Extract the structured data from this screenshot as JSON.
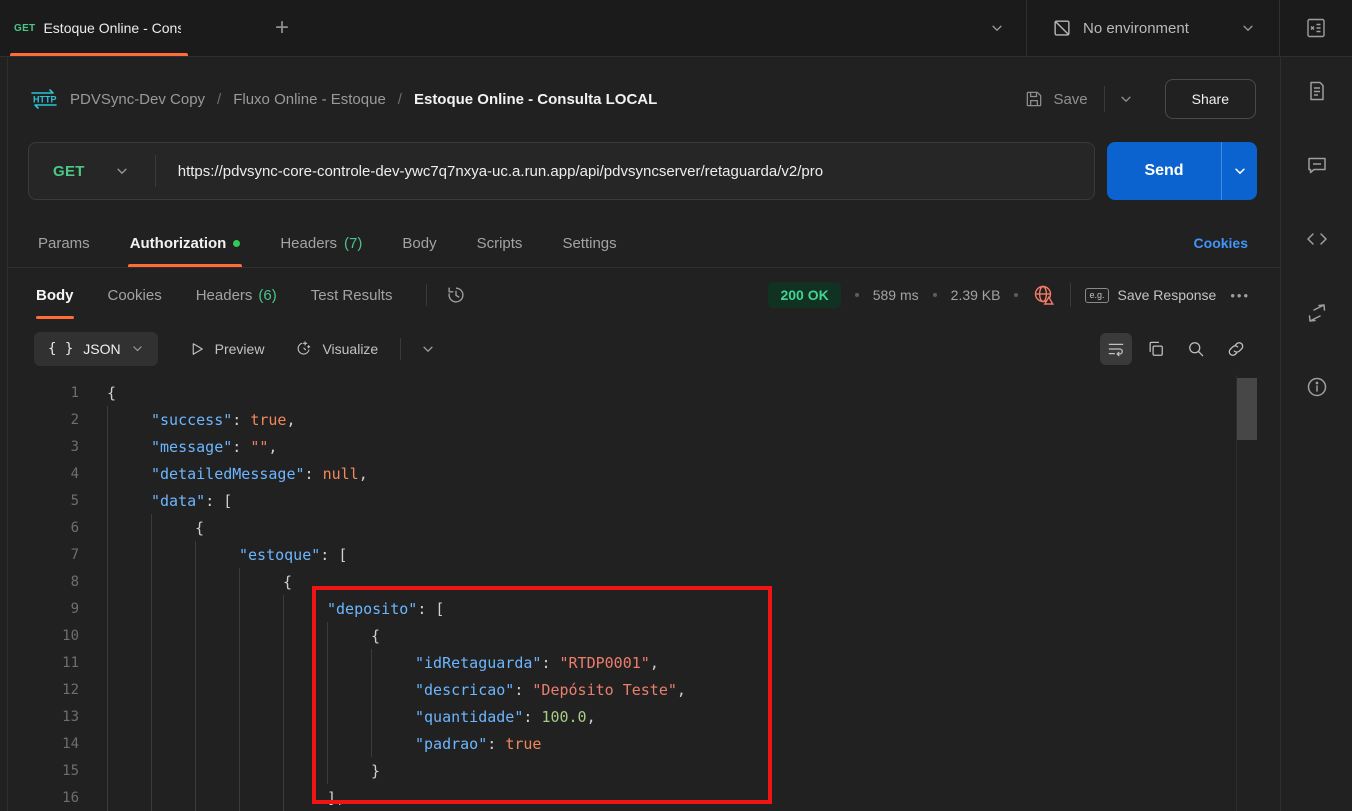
{
  "colors": {
    "accent_orange": "#ff6c37",
    "method_green": "#4ac885",
    "count_green": "#4cc38a",
    "link_blue": "#4294f7",
    "send_blue": "#0a63cf",
    "status_green": "#42d392",
    "annotation_red": "#f01414",
    "http_icon_cyan": "#2bc4d9",
    "globe_warning": "#f47b67",
    "code_key_blue": "#6cb6ff",
    "code_string_salmon": "#ec7e6d",
    "code_bool_orange": "#f0885c",
    "code_number_green": "#a9cc84"
  },
  "topbar": {
    "tab": {
      "method": "GET",
      "title": "Estoque Online - Consult"
    },
    "new_tab_label": "+",
    "environment_label": "No environment"
  },
  "header": {
    "breadcrumb": [
      "PDVSync-Dev Copy",
      "Fluxo Online - Estoque",
      "Estoque Online - Consulta LOCAL"
    ],
    "separator": "/",
    "save_label": "Save",
    "share_label": "Share"
  },
  "request": {
    "method": "GET",
    "url": "https://pdvsync-core-controle-dev-ywc7q7nxya-uc.a.run.app/api/pdvsyncserver/retaguarda/v2/pro",
    "send_label": "Send",
    "tabs": [
      {
        "label": "Params"
      },
      {
        "label": "Authorization"
      },
      {
        "label": "Headers",
        "count": "(7)"
      },
      {
        "label": "Body"
      },
      {
        "label": "Scripts"
      },
      {
        "label": "Settings"
      }
    ],
    "cookies_link": "Cookies"
  },
  "response": {
    "tabs": [
      {
        "label": "Body"
      },
      {
        "label": "Cookies"
      },
      {
        "label": "Headers",
        "count": "(6)"
      },
      {
        "label": "Test Results"
      }
    ],
    "status": "200 OK",
    "time": "589 ms",
    "size": "2.39 KB",
    "eg_label": "e.g.",
    "save_response_label": "Save Response",
    "more_label": "•••"
  },
  "viewer": {
    "braces": "{ }",
    "format_label": "JSON",
    "preview_label": "Preview",
    "visualize_label": "Visualize"
  },
  "code": {
    "lines": [
      {
        "num": 1,
        "depth": 0,
        "segments": [
          [
            "p",
            "{"
          ]
        ]
      },
      {
        "num": 2,
        "depth": 1,
        "segments": [
          [
            "k",
            "\"success\""
          ],
          [
            "p",
            ": "
          ],
          [
            "b",
            "true"
          ],
          [
            "p",
            ","
          ]
        ]
      },
      {
        "num": 3,
        "depth": 1,
        "segments": [
          [
            "k",
            "\"message\""
          ],
          [
            "p",
            ": "
          ],
          [
            "s",
            "\"\""
          ],
          [
            "p",
            ","
          ]
        ]
      },
      {
        "num": 4,
        "depth": 1,
        "segments": [
          [
            "k",
            "\"detailedMessage\""
          ],
          [
            "p",
            ": "
          ],
          [
            "b",
            "null"
          ],
          [
            "p",
            ","
          ]
        ]
      },
      {
        "num": 5,
        "depth": 1,
        "segments": [
          [
            "k",
            "\"data\""
          ],
          [
            "p",
            ": ["
          ]
        ]
      },
      {
        "num": 6,
        "depth": 2,
        "segments": [
          [
            "p",
            "{"
          ]
        ]
      },
      {
        "num": 7,
        "depth": 3,
        "segments": [
          [
            "k",
            "\"estoque\""
          ],
          [
            "p",
            ": ["
          ]
        ]
      },
      {
        "num": 8,
        "depth": 4,
        "segments": [
          [
            "p",
            "{"
          ]
        ]
      },
      {
        "num": 9,
        "depth": 5,
        "segments": [
          [
            "k",
            "\"deposito\""
          ],
          [
            "p",
            ": ["
          ]
        ]
      },
      {
        "num": 10,
        "depth": 6,
        "segments": [
          [
            "p",
            "{"
          ]
        ]
      },
      {
        "num": 11,
        "depth": 7,
        "segments": [
          [
            "k",
            "\"idRetaguarda\""
          ],
          [
            "p",
            ": "
          ],
          [
            "s",
            "\"RTDP0001\""
          ],
          [
            "p",
            ","
          ]
        ]
      },
      {
        "num": 12,
        "depth": 7,
        "segments": [
          [
            "k",
            "\"descricao\""
          ],
          [
            "p",
            ": "
          ],
          [
            "s",
            "\"Depósito Teste\""
          ],
          [
            "p",
            ","
          ]
        ]
      },
      {
        "num": 13,
        "depth": 7,
        "segments": [
          [
            "k",
            "\"quantidade\""
          ],
          [
            "p",
            ": "
          ],
          [
            "n",
            "100.0"
          ],
          [
            "p",
            ","
          ]
        ]
      },
      {
        "num": 14,
        "depth": 7,
        "segments": [
          [
            "k",
            "\"padrao\""
          ],
          [
            "p",
            ": "
          ],
          [
            "b",
            "true"
          ]
        ]
      },
      {
        "num": 15,
        "depth": 6,
        "segments": [
          [
            "p",
            "}"
          ]
        ]
      },
      {
        "num": 16,
        "depth": 5,
        "segments": [
          [
            "p",
            "],"
          ]
        ]
      }
    ]
  }
}
